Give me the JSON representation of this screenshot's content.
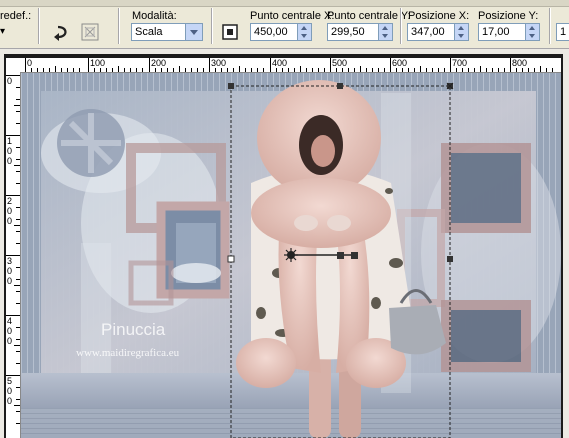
{
  "toolbar": {
    "preset_label": "redef.:",
    "mode_label": "Modalità:",
    "mode_value": "Scala",
    "center_x_label": "Punto centrale X:",
    "center_x_value": "450,00",
    "center_y_label": "Punto centrale Y:",
    "center_y_value": "299,50",
    "pos_x_label": "Posizione X:",
    "pos_x_value": "347,00",
    "pos_y_label": "Posizione Y:",
    "pos_y_value": "17,00",
    "cut_value": "1"
  },
  "ruler_top": [
    "0",
    "100",
    "200",
    "300",
    "400",
    "500",
    "600",
    "700",
    "800"
  ],
  "ruler_left": [
    "0",
    "1\n0\n0",
    "2\n0\n0",
    "3\n0\n0",
    "4\n0\n0",
    "5\n0\n0"
  ],
  "watermark": {
    "name": "Pinuccia",
    "site": "www.maidiregrafica.eu"
  },
  "colors": {
    "toolbar_bg": "#ece9d8",
    "input_border": "#7f9db9",
    "frame_mauve": "#c3a7a8",
    "coat_pink": "#e6c5bd"
  }
}
